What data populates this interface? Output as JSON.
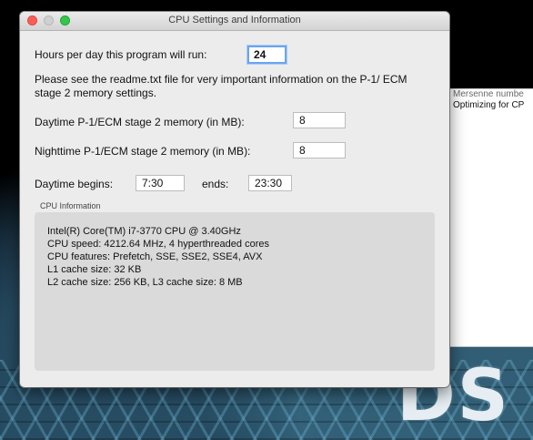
{
  "window": {
    "title": "CPU Settings and Information"
  },
  "form": {
    "hours_label": "Hours per day this program will run:",
    "hours_value": "24",
    "readme_note": "Please see the readme.txt file for very important information on the P-1/ ECM stage 2 memory settings.",
    "daytime_mem_label": "Daytime P-1/ECM stage 2 memory (in MB):",
    "daytime_mem_value": "8",
    "nighttime_mem_label": "Nighttime P-1/ECM stage 2 memory (in MB):",
    "nighttime_mem_value": "8",
    "daytime_begins_label": "Daytime begins:",
    "daytime_begins_value": "7:30",
    "ends_label": "ends:",
    "ends_value": "23:30"
  },
  "cpu_info": {
    "section_title": "CPU Information",
    "lines": [
      "Intel(R) Core(TM) i7-3770 CPU @ 3.40GHz",
      "CPU speed: 4212.64 MHz, 4 hyperthreaded cores",
      "CPU features: Prefetch, SSE, SSE2, SSE4, AVX",
      "L1 cache size: 32 KB",
      "L2 cache size: 256 KB, L3 cache size: 8 MB"
    ]
  },
  "background_window": {
    "line1": "Mersenne numbe",
    "line2": "Optimizing for CP"
  },
  "desktop": {
    "logo_text": "DS"
  }
}
